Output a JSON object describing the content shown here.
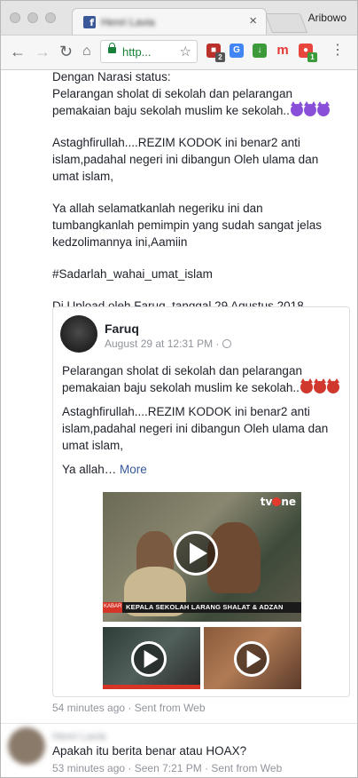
{
  "browser": {
    "tab_title": "Henri Lavia",
    "tab_close": "×",
    "profile_name": "Aribowo",
    "url": "http...",
    "extensions": [
      {
        "name": "ublock-icon",
        "badge": "2",
        "color": "#b9312a"
      },
      {
        "name": "translate-icon",
        "badge": "",
        "color": "#4285f4"
      },
      {
        "name": "download-icon",
        "badge": "",
        "color": "#3c9a3a"
      },
      {
        "name": "m-extension-icon",
        "badge": "",
        "color": "#e53935"
      },
      {
        "name": "red-extension-icon",
        "badge": "1",
        "color": "#e8453c"
      }
    ]
  },
  "message": {
    "lines": [
      "Dengan Narasi status:",
      "Pelarangan sholat di sekolah dan pelarangan pemakaian baju sekolah muslim ke sekolah..",
      "Astaghfirullah....REZIM KODOK ini benar2 anti islam,padahal negeri ini dibangun Oleh ulama dan umat islam,",
      "Ya allah selamatkanlah negeriku ini dan tumbangkanlah pemimpin yang sudah sangat jelas kedzolimannya ini,Aamiin",
      "#Sadarlah_wahai_umat_islam",
      "Di Upload oleh Faruq, tanggal 29 Agustus 2018"
    ]
  },
  "shared_post": {
    "author": "Faruq",
    "meta": "August 29 at 12:31 PM · ",
    "para1": "Pelarangan sholat di sekolah dan pelarangan pemakaian baju sekolah muslim ke sekolah..",
    "para2": "Astaghfirullah....REZIM KODOK ini benar2 anti islam,padahal negeri ini dibangun Oleh ulama dan umat islam,",
    "para3": "Ya allah… ",
    "more_link": "More",
    "video_channel": "tv",
    "video_channel_suffix": "ne",
    "video_caption": "KEPALA SEKOLAH LARANG SHALAT & ADZAN",
    "video_red_tag": "KABAR"
  },
  "sent_info_1": "54 minutes ago · Sent from Web",
  "reply": {
    "sender": "Henri Lavia",
    "text": "Apakah itu berita benar atau HOAX?",
    "meta": "53 minutes ago · Seen 7:21 PM · Sent from Web"
  }
}
